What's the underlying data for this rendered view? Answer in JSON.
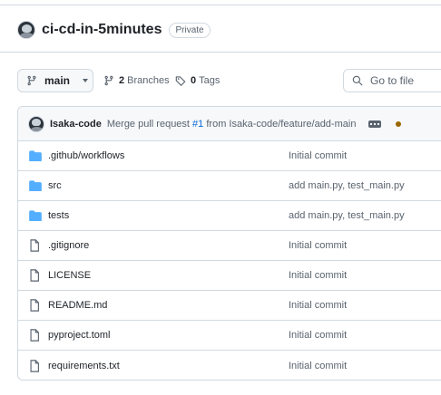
{
  "repo": {
    "name": "ci-cd-in-5minutes",
    "visibility": "Private"
  },
  "toolbar": {
    "branch_name": "main",
    "branches_count": "2",
    "branches_label": "Branches",
    "tags_count": "0",
    "tags_label": "Tags",
    "search_placeholder": "Go to file"
  },
  "latest_commit": {
    "author": "Isaka-code",
    "message_prefix": "Merge pull request ",
    "pr_number": "#1",
    "message_suffix": " from Isaka-code/feature/add-main",
    "status_color": "#9a6700"
  },
  "files": [
    {
      "name": ".github/workflows",
      "type": "folder",
      "commit": "Initial commit"
    },
    {
      "name": "src",
      "type": "folder",
      "commit": "add main.py, test_main.py"
    },
    {
      "name": "tests",
      "type": "folder",
      "commit": "add main.py, test_main.py"
    },
    {
      "name": ".gitignore",
      "type": "file",
      "commit": "Initial commit"
    },
    {
      "name": "LICENSE",
      "type": "file",
      "commit": "Initial commit"
    },
    {
      "name": "README.md",
      "type": "file",
      "commit": "Initial commit"
    },
    {
      "name": "pyproject.toml",
      "type": "file",
      "commit": "Initial commit"
    },
    {
      "name": "requirements.txt",
      "type": "file",
      "commit": "Initial commit"
    }
  ],
  "colors": {
    "folder_icon": "#54aeff",
    "link": "#0969da"
  }
}
